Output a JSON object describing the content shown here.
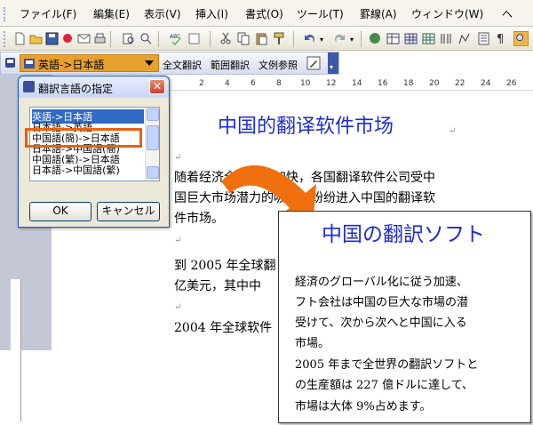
{
  "menubar": {
    "items": [
      "ファイル(F)",
      "編集(E)",
      "表示(V)",
      "挿入(I)",
      "書式(O)",
      "ツール(T)",
      "罫線(A)",
      "ウィンドウ(W)",
      "ヘ"
    ]
  },
  "toolbar2": {
    "lang_selected": "英語->日本語",
    "buttons": [
      "全文翻訳",
      "範囲翻訳",
      "文例参照"
    ]
  },
  "ruler": {
    "numbers": [
      "2",
      "4",
      "6",
      "8",
      "10",
      "12",
      "14",
      "16",
      "18",
      "20",
      "22",
      "24",
      "26"
    ]
  },
  "dialog": {
    "title": "翻訳言語の指定",
    "options": [
      "英語->日本語",
      "日本語->英語",
      "中国語(簡)->日本語",
      "日本語->中国語(簡)",
      "中国語(繁)->日本語",
      "日本語->中国語(繁)"
    ],
    "selected_index": 0,
    "highlighted_index": 2,
    "ok_label": "OK",
    "cancel_label": "キャンセル"
  },
  "document": {
    "title": "中国的翻译软件市场",
    "para1": [
      "随着经济全球化的加快，各国翻译软件公司受中",
      "国巨大市场潜力的吸引，纷纷进入中国的翻译软",
      "件市场。"
    ],
    "para2": [
      "到 2005 年全球翻",
      "亿美元，其中中"
    ],
    "para3": "2004 年全球软件"
  },
  "popup": {
    "title": "中国の翻訳ソフト",
    "lines": [
      "経済のグローバル化に従う加速、",
      "フト会社は中国の巨大な市場の潜",
      "受けて、次から次へと中国に入る",
      "市場。",
      "2005 年まで全世界の翻訳ソフトと",
      "の生産額は 227 億ドルに達して、",
      "市場は大体 9%占めます。"
    ]
  },
  "colors": {
    "accent_orange": "#e8620e",
    "translation_blue": "#1e2cd6",
    "dialog_border": "#1a4fd0"
  }
}
